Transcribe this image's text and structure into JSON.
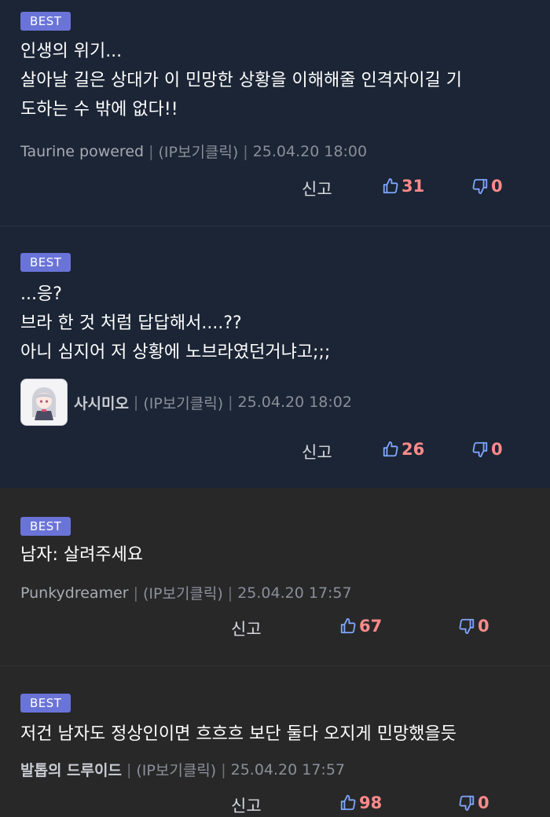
{
  "badge_label": "BEST",
  "report_label": "신고",
  "ip_label": "(IP보기클릭)",
  "colors": {
    "badge": "#6a74d8",
    "count": "#ff8a8a",
    "icon": "#7fa6ff"
  },
  "comments": [
    {
      "lines": [
        "인생의 위기...",
        "살아날 길은 상대가 이 민망한 상황을 이해해줄 인격자이길 기",
        "도하는 수 밖에 없다!!"
      ],
      "author": "Taurine powered",
      "date": "25.04.20 18:00",
      "likes": "31",
      "dislikes": "0"
    },
    {
      "lines": [
        "...응?",
        "브라 한 것 처럼 답답해서....??",
        "아니 심지어 저 상황에 노브라였던거냐고;;;"
      ],
      "author": "사시미오",
      "date": "25.04.20 18:02",
      "likes": "26",
      "dislikes": "0"
    },
    {
      "lines": [
        "남자: 살려주세요"
      ],
      "author": "Punkydreamer",
      "date": "25.04.20 17:57",
      "likes": "67",
      "dislikes": "0"
    },
    {
      "lines": [
        "저건 남자도 정상인이면 흐흐흐 보단 둘다 오지게 민망했을듯"
      ],
      "author": "발톱의 드루이드",
      "date": "25.04.20 17:57",
      "likes": "98",
      "dislikes": "0"
    }
  ]
}
